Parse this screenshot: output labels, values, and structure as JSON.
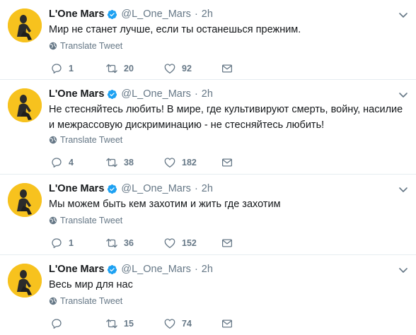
{
  "translate_label": "Translate Tweet",
  "colors": {
    "avatar_bg": "#f7c21e",
    "verified": "#1da1f2",
    "muted": "#657786",
    "divider": "#e6ecf0"
  },
  "tweets": [
    {
      "name": "L'One Mars",
      "handle": "@L_One_Mars",
      "separator": "·",
      "time": "2h",
      "text": "Мир не станет лучше, если ты останешься прежним.",
      "replies": "1",
      "retweets": "20",
      "likes": "92"
    },
    {
      "name": "L'One Mars",
      "handle": "@L_One_Mars",
      "separator": "·",
      "time": "2h",
      "text": "Не стесняйтесь любить! В мире, где культивируют смерть, войну, насилие и межрассовую дискриминацию - не стесняйтесь любить!",
      "replies": "4",
      "retweets": "38",
      "likes": "182"
    },
    {
      "name": "L'One Mars",
      "handle": "@L_One_Mars",
      "separator": "·",
      "time": "2h",
      "text": "Мы можем быть кем захотим и жить где захотим",
      "replies": "1",
      "retweets": "36",
      "likes": "152"
    },
    {
      "name": "L'One Mars",
      "handle": "@L_One_Mars",
      "separator": "·",
      "time": "2h",
      "text": "Весь мир для нас",
      "replies": "",
      "retweets": "15",
      "likes": "74"
    }
  ]
}
